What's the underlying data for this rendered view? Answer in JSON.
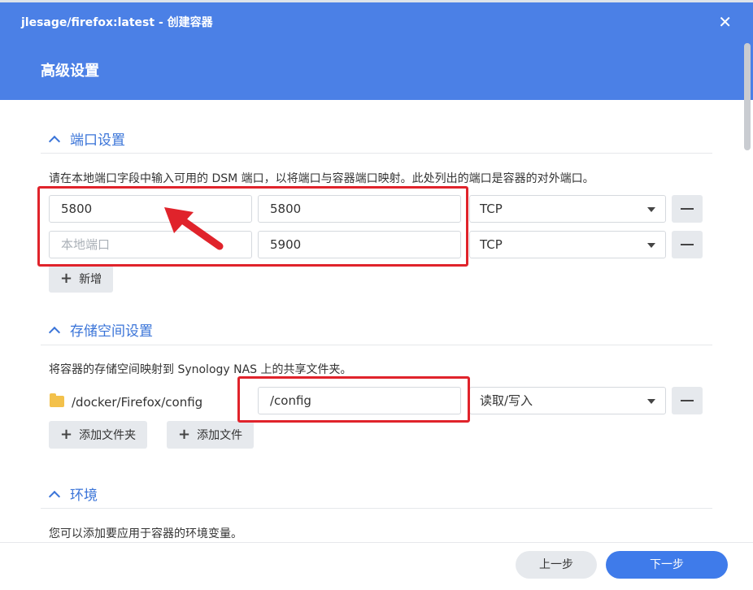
{
  "window": {
    "title": "jlesage/firefox:latest - 创建容器",
    "step_title": "高级设置"
  },
  "ports": {
    "section_title": "端口设置",
    "description": "请在本地端口字段中输入可用的 DSM 端口，以将端口与容器端口映射。此处列出的端口是容器的对外端口。",
    "rows": [
      {
        "local_port": "5800",
        "local_placeholder": "本地端口",
        "container_port": "5800",
        "protocol": "TCP"
      },
      {
        "local_port": "",
        "local_placeholder": "本地端口",
        "container_port": "5900",
        "protocol": "TCP"
      }
    ],
    "add_label": "新增"
  },
  "storage": {
    "section_title": "存储空间设置",
    "description": "将容器的存储空间映射到 Synology NAS 上的共享文件夹。",
    "rows": [
      {
        "host_path": "/docker/Firefox/config",
        "mount_path": "/config",
        "permission": "读取/写入"
      }
    ],
    "add_folder_label": "添加文件夹",
    "add_file_label": "添加文件"
  },
  "environment": {
    "section_title": "环境",
    "description": "您可以添加要应用于容器的环境变量。"
  },
  "footer": {
    "prev_label": "上一步",
    "next_label": "下一步"
  },
  "icons": {
    "close": "close-icon",
    "collapse": "chevron-up-icon",
    "remove": "minus-icon",
    "add": "plus-icon",
    "folder": "folder-icon",
    "dropdown": "caret-down-icon"
  },
  "colors": {
    "header_bg": "#4b80e6",
    "accent": "#3a74d8",
    "primary_button": "#3f7bea",
    "annotation": "#e0232b"
  }
}
